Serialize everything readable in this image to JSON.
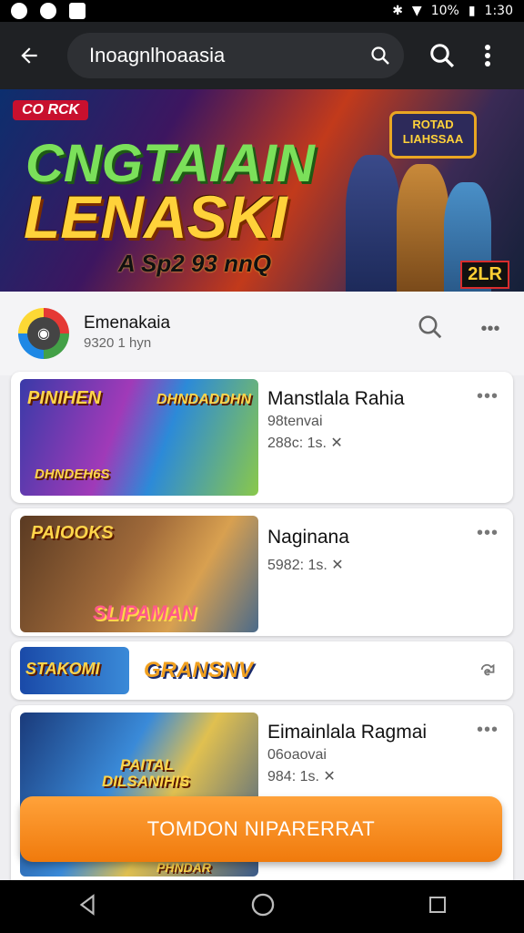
{
  "status_bar": {
    "time": "1:30",
    "battery": "10%"
  },
  "app_bar": {
    "search_text": "Inoagnlhoaasia"
  },
  "banner": {
    "logo_text": "CO RCK",
    "title_line1": "CNGTAIAIN",
    "title_line2": "LENASKI",
    "subtitle": "A Sp2 93 nnQ",
    "sign_text": "ROTAD LIAHSSAA",
    "badge_text": "2LR"
  },
  "header": {
    "name": "Emenakaia",
    "subtitle": "9320 1 hyn"
  },
  "cards": [
    {
      "title": "Manstlala Rahia",
      "meta1": "98tenvai",
      "meta2": "288c: 1s. ✕",
      "thumb_text_a": "PINIHEN",
      "thumb_text_b": "DHNDADDHN",
      "thumb_text_c": "DHNDEH6S"
    },
    {
      "title": "Naginana",
      "meta1": "",
      "meta2": "5982: 1s. ✕",
      "thumb_text_a": "PAIOOKS",
      "thumb_text_b": "SLIPAMAN",
      "thumb_text_c": ""
    },
    {
      "title": "",
      "meta1": "",
      "meta2": "",
      "thumb_text_a": "STAKOMI",
      "thumb_text_b": "GRANSNV",
      "thumb_text_c": ""
    },
    {
      "title": "Eimainlala Ragmai",
      "meta1": "06oaovai",
      "meta2": "984: 1s. ✕",
      "thumb_text_a": "PAITAL",
      "thumb_text_b": "DILSANIHIS",
      "thumb_text_c": "PHNDAR"
    }
  ],
  "cta": {
    "label": "TOMDON NIPARERRAT"
  },
  "colors": {
    "accent": "#f5891b",
    "app_bar": "#1f2124"
  }
}
